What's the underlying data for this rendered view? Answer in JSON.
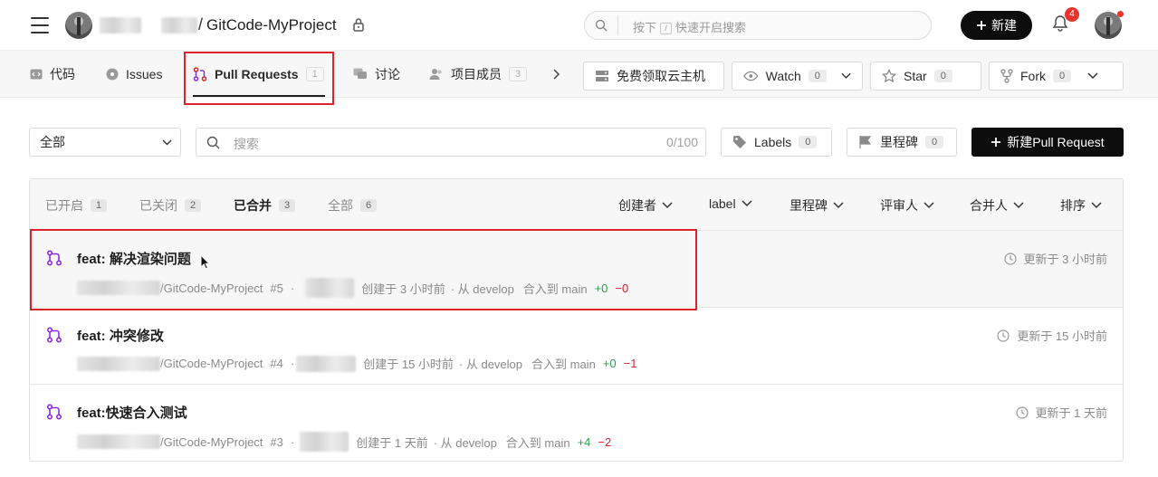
{
  "header": {
    "project_sep": "/",
    "project_name": "GitCode-MyProject",
    "search_placeholder_pre": "按下",
    "search_key": "/",
    "search_placeholder_post": "快速开启搜索",
    "new_button": "新建",
    "notification_count": "4"
  },
  "tabs": [
    {
      "label": "代码"
    },
    {
      "label": "Issues"
    },
    {
      "label": "Pull Requests",
      "count": "1"
    },
    {
      "label": "讨论"
    },
    {
      "label": "项目成员",
      "count": "3"
    }
  ],
  "repo_actions": {
    "cloud": "免费领取云主机",
    "watch": {
      "label": "Watch",
      "count": "0"
    },
    "star": {
      "label": "Star",
      "count": "0"
    },
    "fork": {
      "label": "Fork",
      "count": "0"
    }
  },
  "filters": {
    "scope_value": "全部",
    "search_placeholder": "搜索",
    "search_count": "0/100",
    "labels": {
      "label": "Labels",
      "count": "0"
    },
    "milestone": {
      "label": "里程碑",
      "count": "0"
    },
    "new_pr": "新建Pull Request"
  },
  "states": [
    {
      "label": "已开启",
      "count": "1"
    },
    {
      "label": "已关闭",
      "count": "2"
    },
    {
      "label": "已合并",
      "count": "3"
    },
    {
      "label": "全部",
      "count": "6"
    }
  ],
  "list_filters": [
    "创建者",
    "label",
    "里程碑",
    "评审人",
    "合并人",
    "排序"
  ],
  "pull_requests": [
    {
      "title": "feat: 解决渲染问题",
      "repo": "/GitCode-MyProject",
      "number": "#5",
      "dot": "·",
      "created": "创建于 3 小时前",
      "from": "· 从 develop",
      "into": "合入到 main",
      "additions": "+0",
      "deletions": "−0",
      "updated": "更新于 3 小时前"
    },
    {
      "title": "feat: 冲突修改",
      "repo": "/GitCode-MyProject",
      "number": "#4",
      "dot": "·",
      "created": "创建于 15 小时前",
      "from": "· 从 develop",
      "into": "合入到 main",
      "additions": "+0",
      "deletions": "−1",
      "updated": "更新于 15 小时前"
    },
    {
      "title": "feat:快速合入测试",
      "repo": "/GitCode-MyProject",
      "number": "#3",
      "dot": "·",
      "created": "创建于 1 天前",
      "from": "· 从 develop",
      "into": "合入到 main",
      "additions": "+4",
      "deletions": "−2",
      "updated": "更新于 1 天前"
    }
  ],
  "colors": {
    "accent": "#0d0d0d",
    "highlight": "#d9232d",
    "addition": "#2aa44f",
    "deletion": "#d9232d",
    "pr_icon": "#8a2be2"
  }
}
